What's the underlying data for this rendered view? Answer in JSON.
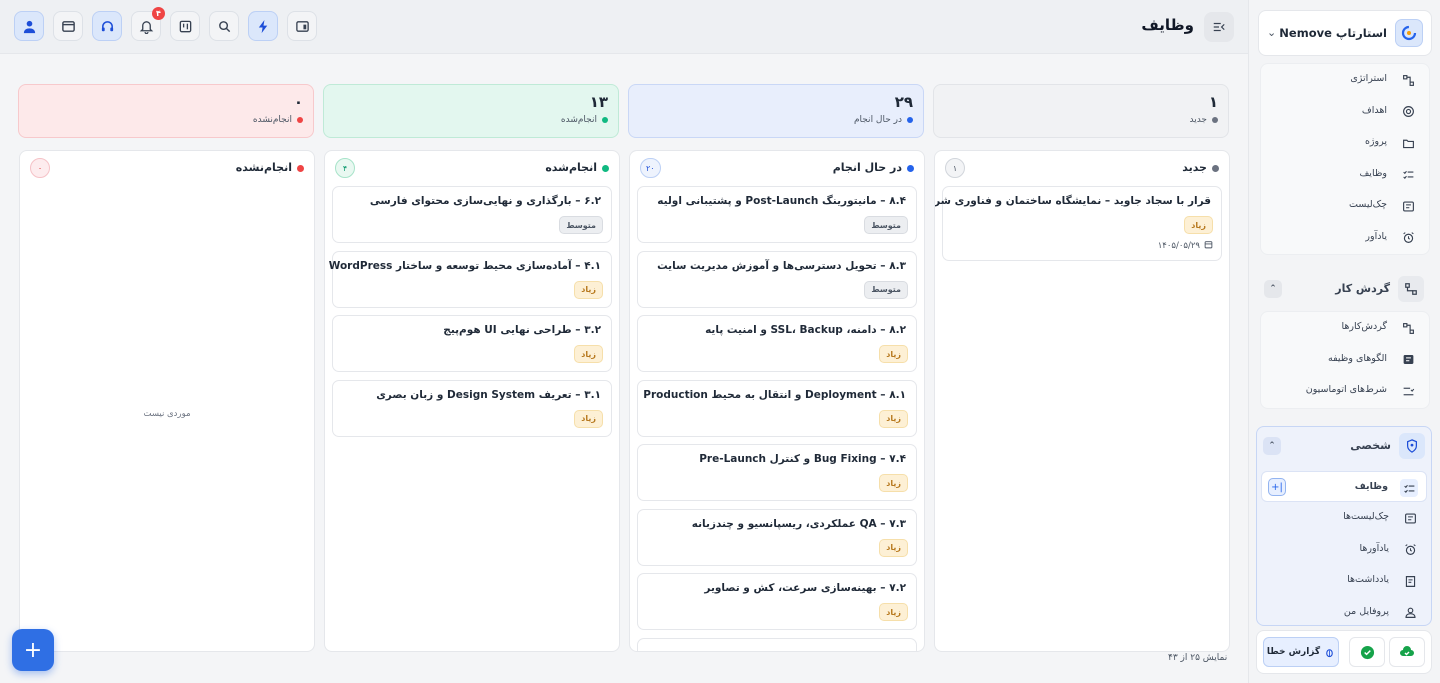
{
  "header": {
    "title": "وظایف",
    "notification_count": "۴"
  },
  "sidebar": {
    "org_name": "استارتاپ Nemove",
    "strategy_items": [
      {
        "label": "استراتژی",
        "icon": "strategy-icon"
      },
      {
        "label": "اهداف",
        "icon": "target-icon"
      },
      {
        "label": "پروژه",
        "icon": "folder-icon"
      },
      {
        "label": "وظایف",
        "icon": "tasks-icon"
      },
      {
        "label": "چک‌لیست",
        "icon": "checklist-icon"
      },
      {
        "label": "یادآور",
        "icon": "alarm-icon"
      }
    ],
    "workflow": {
      "label": "گردش کار",
      "items": [
        {
          "label": "گردش‌کارها",
          "icon": "workflow-icon"
        },
        {
          "label": "الگوهای وظیفه",
          "icon": "template-icon"
        },
        {
          "label": "شرط‌های اتوماسیون",
          "icon": "automation-icon"
        }
      ]
    },
    "personal": {
      "label": "شخصی",
      "items": [
        {
          "label": "وظایف",
          "icon": "tasks-icon"
        },
        {
          "label": "چک‌لیست‌ها",
          "icon": "checklist-icon"
        },
        {
          "label": "یادآورها",
          "icon": "alarm-icon"
        },
        {
          "label": "یادداشت‌ها",
          "icon": "note-icon"
        },
        {
          "label": "پروفایل من",
          "icon": "user-icon"
        }
      ]
    },
    "report_label": "گزارش خطا"
  },
  "stats": [
    {
      "num": "۱",
      "label": "جدید",
      "color": "#6b7280"
    },
    {
      "num": "۲۹",
      "label": "در حال انجام",
      "color": "#2563eb"
    },
    {
      "num": "۱۳",
      "label": "انجام‌شده",
      "color": "#10b981"
    },
    {
      "num": "۰",
      "label": "انجام‌نشده",
      "color": "#ef4444"
    }
  ],
  "columns": [
    {
      "title": "جدید",
      "count": "۱",
      "color": "#6b7280",
      "cards": [
        {
          "title": "قرار با سجاد جاوید – نمایشگاه ساختمان و فناوری شریف",
          "priority": "زیاد",
          "level": "high",
          "date": "۱۴۰۵/۰۵/۲۹"
        }
      ]
    },
    {
      "title": "در حال انجام",
      "count": "۲۰",
      "color": "#2563eb",
      "cards": [
        {
          "title": "۸.۴ – مانیتورینگ Post-Launch و پشتیبانی اولیه",
          "priority": "متوسط",
          "level": "med"
        },
        {
          "title": "۸.۳ – تحویل دسترسی‌ها و آموزش مدیریت سایت",
          "priority": "متوسط",
          "level": "med"
        },
        {
          "title": "۸.۲ – دامنه، SSL، Backup و امنیت پایه",
          "priority": "زیاد",
          "level": "high"
        },
        {
          "title": "۸.۱ – Deployment و انتقال به محیط Production",
          "priority": "زیاد",
          "level": "high"
        },
        {
          "title": "۷.۴ – Bug Fixing و کنترل Pre-Launch",
          "priority": "زیاد",
          "level": "high"
        },
        {
          "title": "۷.۳ – QA عملکردی، ریسپانسیو و چندزبانه",
          "priority": "زیاد",
          "level": "high"
        },
        {
          "title": "۷.۲ – بهینه‌سازی سرعت، کش و تصاویر",
          "priority": "زیاد",
          "level": "high"
        }
      ]
    },
    {
      "title": "انجام‌شده",
      "count": "۴",
      "color": "#10b981",
      "cards": [
        {
          "title": "۶.۲ – بارگذاری و نهایی‌سازی محتوای فارسی",
          "priority": "متوسط",
          "level": "med"
        },
        {
          "title": "۴.۱ – آماده‌سازی محیط توسعه و ساختار WordPress",
          "priority": "زیاد",
          "level": "high"
        },
        {
          "title": "۳.۲ – طراحی نهایی UI هوم‌پیج",
          "priority": "زیاد",
          "level": "high"
        },
        {
          "title": "۳.۱ – تعریف Design System و زبان بصری",
          "priority": "زیاد",
          "level": "high"
        }
      ]
    },
    {
      "title": "انجام‌نشده",
      "count": "۰",
      "color": "#ef4444",
      "cards": [],
      "empty_text": "موردی نیست"
    }
  ],
  "footer": {
    "showing": "نمایش ۲۵ از ۴۳"
  }
}
